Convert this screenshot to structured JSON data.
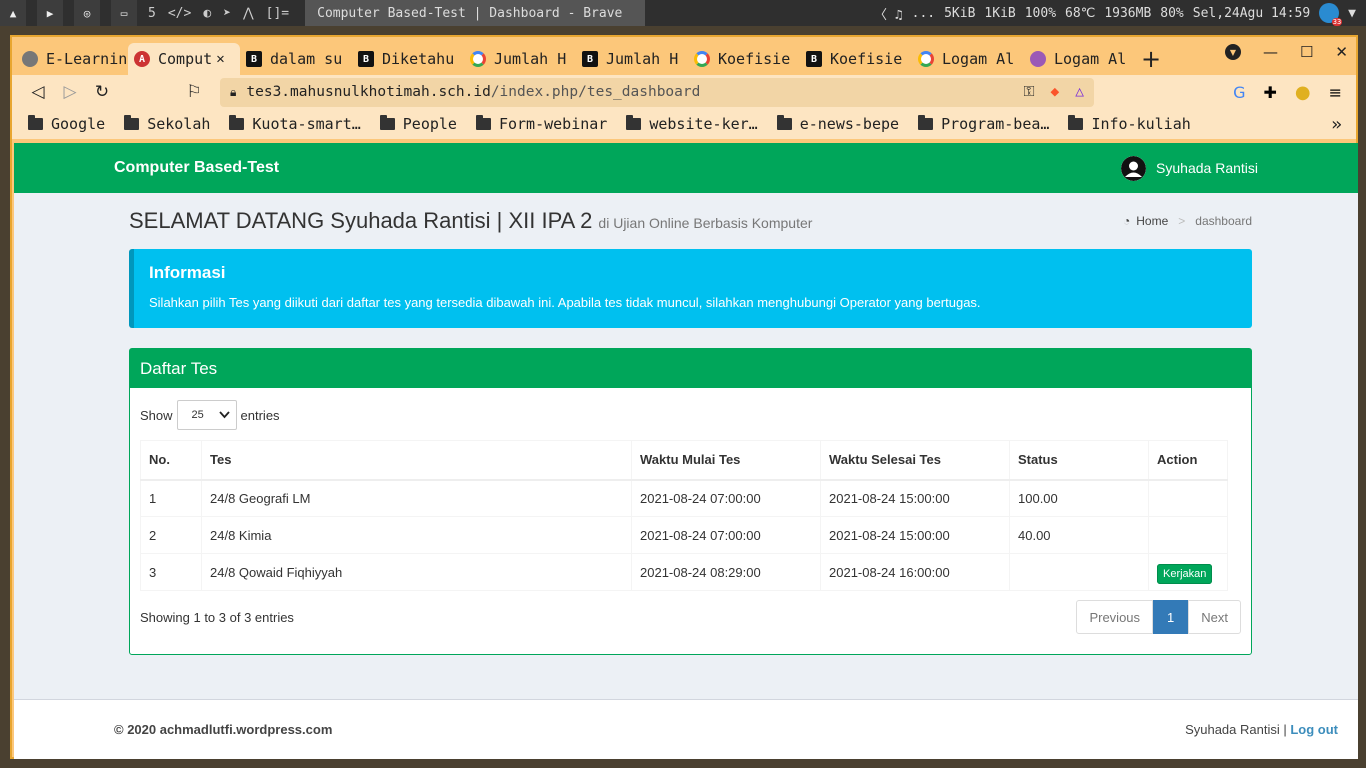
{
  "system_bar": {
    "workspace": "5",
    "layout": "[]=",
    "window_title": "Computer Based-Test | Dashboard - Brave",
    "media": "...",
    "net_down": "5KiB",
    "net_up": "1KiB",
    "cpu": "100%",
    "temp": "68℃",
    "mem": "1936MB",
    "volume": "80%",
    "datetime": "Sel,24Agu 14:59",
    "notif_count": "33"
  },
  "tabs": [
    {
      "label": "E-Learnin",
      "icon": "globe-icon"
    },
    {
      "label": "Comput",
      "icon": "app-icon",
      "active": true
    },
    {
      "label": "dalam su",
      "icon": "brainly-icon"
    },
    {
      "label": "Diketahu",
      "icon": "brainly-icon"
    },
    {
      "label": "Jumlah H",
      "icon": "google-icon"
    },
    {
      "label": "Jumlah H",
      "icon": "brainly-icon"
    },
    {
      "label": "Koefisie",
      "icon": "google-icon"
    },
    {
      "label": "Koefisie",
      "icon": "brainly-icon"
    },
    {
      "label": "Logam Al",
      "icon": "google-icon"
    },
    {
      "label": "Logam Al",
      "icon": "quiz-icon"
    }
  ],
  "url": {
    "host": "tes3.mahusnulkhotimah.sch.id",
    "path": "/index.php/tes_dashboard"
  },
  "bookmarks": [
    "Google",
    "Sekolah",
    "Kuota-smart…",
    "People",
    "Form-webinar",
    "website-ker…",
    "e-news-bepe",
    "Program-bea…",
    "Info-kuliah"
  ],
  "page": {
    "brand": "Computer Based-Test",
    "user_name": "Syuhada Rantisi",
    "heading": "SELAMAT DATANG Syuhada Rantisi | XII IPA 2",
    "subheading": "di Ujian Online Berbasis Komputer",
    "breadcrumb": {
      "home": "Home",
      "current": "dashboard"
    },
    "info": {
      "title": "Informasi",
      "text": "Silahkan pilih Tes yang diikuti dari daftar tes yang tersedia dibawah ini. Apabila tes tidak muncul, silahkan menghubungi Operator yang bertugas."
    },
    "box_title": "Daftar Tes",
    "length": {
      "show": "Show",
      "value": "25",
      "entries": "entries"
    },
    "table": {
      "headers": [
        "No.",
        "Tes",
        "Waktu Mulai Tes",
        "Waktu Selesai Tes",
        "Status",
        "Action"
      ],
      "rows": [
        [
          "1",
          "24/8 Geografi LM",
          "2021-08-24 07:00:00",
          "2021-08-24 15:00:00",
          "100.00",
          ""
        ],
        [
          "2",
          "24/8 Kimia",
          "2021-08-24 07:00:00",
          "2021-08-24 15:00:00",
          "40.00",
          ""
        ],
        [
          "3",
          "24/8 Qowaid Fiqhiyyah",
          "2021-08-24 08:29:00",
          "2021-08-24 16:00:00",
          "",
          "Kerjakan"
        ]
      ]
    },
    "info_text": "Showing 1 to 3 of 3 entries",
    "pager": {
      "previous": "Previous",
      "current": "1",
      "next": "Next"
    },
    "footer": {
      "copyright": "© 2020 achmadlutfi.wordpress.com",
      "user": "Syuhada Rantisi",
      "sep": " | ",
      "logout": "Log out"
    }
  }
}
